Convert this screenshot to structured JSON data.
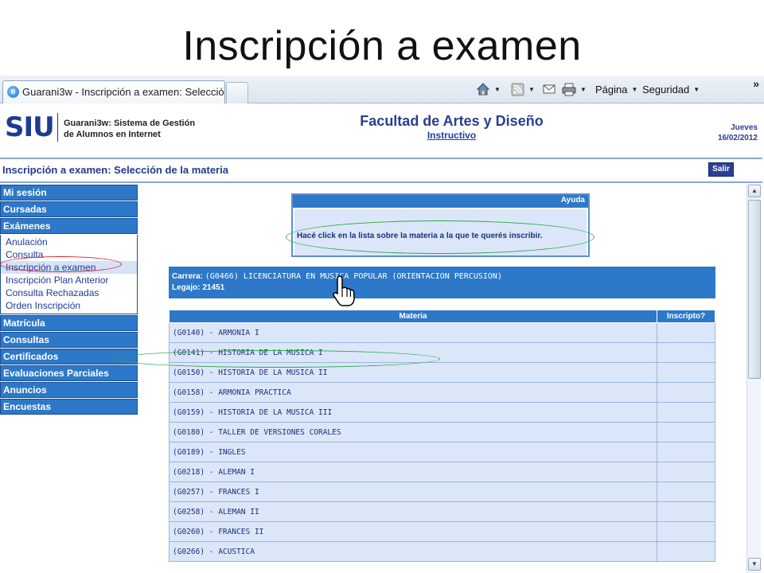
{
  "slide": {
    "title": "Inscripción a examen"
  },
  "browser": {
    "tab_title": "Guarani3w - Inscripción a examen: Selecció...",
    "commands": {
      "page": "Página",
      "security": "Seguridad"
    },
    "overflow": "»"
  },
  "header": {
    "logo": "SIU",
    "system_line1": "Guarani3w: Sistema de Gestión",
    "system_line2": "de Alumnos en Internet",
    "faculty": "Facultad de Artes y Diseño",
    "instructivo": "Instructivo",
    "weekday": "Jueves",
    "date": "16/02/2012"
  },
  "page_title": "Inscripción a examen: Selección de la materia",
  "salir": "Salir",
  "menu": {
    "mi_sesion": "Mi sesión",
    "cursadas": "Cursadas",
    "examenes": "Exámenes",
    "examenes_items": [
      "Anulación",
      "Consulta",
      "Inscripción a examen",
      "Inscripción Plan Anterior",
      "Consulta Rechazadas",
      "Orden Inscripción"
    ],
    "matricula": "Matrícula",
    "consultas": "Consultas",
    "certificados": "Certificados",
    "evaluaciones": "Evaluaciones Parciales",
    "anuncios": "Anuncios",
    "encuestas": "Encuestas"
  },
  "ayuda": {
    "header": "Ayuda",
    "text": "Hacé click en la lista sobre la materia a la que te querés inscribir."
  },
  "carrera": {
    "carrera_label": "Carrera:",
    "carrera_value": "(G0466) LICENCIATURA EN MUSICA POPULAR (ORIENTACION PERCUSION)",
    "legajo_label": "Legajo:",
    "legajo_value": "21451"
  },
  "table": {
    "col_materia": "Materia",
    "col_inscripto": "Inscripto?",
    "rows": [
      "(G0140) - ARMONIA I",
      "(G0141) - HISTORIA DE LA MUSICA I",
      "(G0150) - HISTORIA DE LA MUSICA II",
      "(G0158) - ARMONIA PRACTICA",
      "(G0159) - HISTORIA DE LA MUSICA III",
      "(G0180) - TALLER DE VERSIONES CORALES",
      "(G0189) - INGLES",
      "(G0218) - ALEMAN I",
      "(G0257) - FRANCES I",
      "(G0258) - ALEMAN II",
      "(G0260) - FRANCES II",
      "(G0266) - ACUSTICA"
    ]
  },
  "colors": {
    "menu_blue": "#2d78c8",
    "row_bg": "#dbe7f8",
    "highlight_red": "#d8202a",
    "highlight_green": "#2ea84a"
  }
}
